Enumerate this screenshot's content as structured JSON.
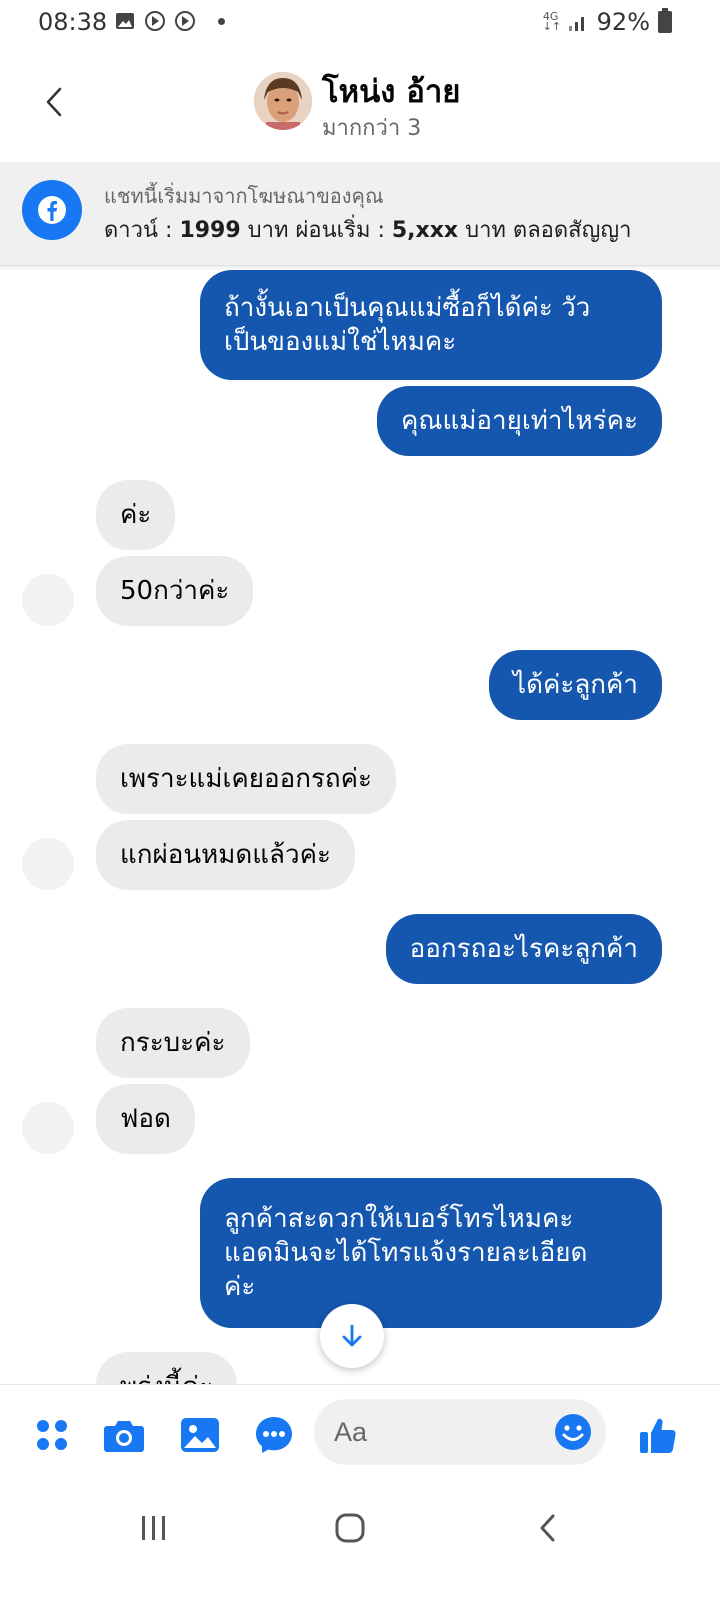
{
  "status_bar": {
    "time": "08:38",
    "network": "4G",
    "battery": "92%"
  },
  "header": {
    "name": "โหน่ง อ้าย",
    "subtitle": "มากกว่า 3"
  },
  "ad_banner": {
    "line1": "แชทนี้เริ่มมาจากโฆษณาของคุณ",
    "line2_prefix": "ดาวน์ : ",
    "line2_bold1": "1999",
    "line2_mid": " บาท ผ่อนเริ่ม : ",
    "line2_bold2": "5,xxx",
    "line2_suffix": " บาท ตลอดสัญญา"
  },
  "messages": [
    {
      "side": "out",
      "text": "ถ้างั้นเอาเป็นคุณแม่ซื้อก็ได้ค่ะ วัว\nเป็นของแม่ใช่ไหมคะ"
    },
    {
      "side": "out",
      "text": "คุณแม่อายุเท่าไหร่คะ"
    },
    {
      "side": "in",
      "text": "ค่ะ"
    },
    {
      "side": "in",
      "text": "50กว่าค่ะ"
    },
    {
      "side": "out",
      "text": "ได้ค่ะลูกค้า"
    },
    {
      "side": "in",
      "text": "เพราะแม่เคยออกรถค่ะ"
    },
    {
      "side": "in",
      "text": "แกผ่อนหมดแล้วค่ะ"
    },
    {
      "side": "out",
      "text": "ออกรถอะไรคะลูกค้า"
    },
    {
      "side": "in",
      "text": "กระบะค่ะ"
    },
    {
      "side": "in",
      "text": "ฟอด"
    },
    {
      "side": "out",
      "text": "ลูกค้าสะดวกให้เบอร์โทรไหมคะ\nแอดมินจะได้โทรแจ้งรายละเอียด\nค่ะ"
    },
    {
      "side": "in",
      "text": "พรุ่งนี้ค่ะ"
    }
  ],
  "composer": {
    "placeholder": "Aa"
  },
  "colors": {
    "outgoing_bubble": "#1557ae",
    "incoming_bubble": "#ebebeb",
    "accent": "#1877f2"
  }
}
